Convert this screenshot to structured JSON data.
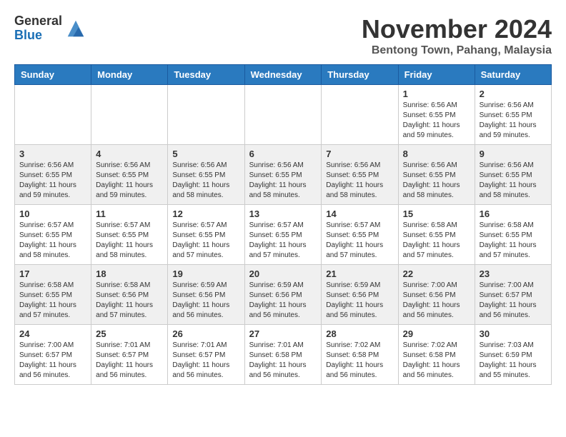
{
  "header": {
    "logo_line1": "General",
    "logo_line2": "Blue",
    "month": "November 2024",
    "location": "Bentong Town, Pahang, Malaysia"
  },
  "weekdays": [
    "Sunday",
    "Monday",
    "Tuesday",
    "Wednesday",
    "Thursday",
    "Friday",
    "Saturday"
  ],
  "weeks": [
    [
      {
        "day": "",
        "info": ""
      },
      {
        "day": "",
        "info": ""
      },
      {
        "day": "",
        "info": ""
      },
      {
        "day": "",
        "info": ""
      },
      {
        "day": "",
        "info": ""
      },
      {
        "day": "1",
        "info": "Sunrise: 6:56 AM\nSunset: 6:55 PM\nDaylight: 11 hours and 59 minutes."
      },
      {
        "day": "2",
        "info": "Sunrise: 6:56 AM\nSunset: 6:55 PM\nDaylight: 11 hours and 59 minutes."
      }
    ],
    [
      {
        "day": "3",
        "info": "Sunrise: 6:56 AM\nSunset: 6:55 PM\nDaylight: 11 hours and 59 minutes."
      },
      {
        "day": "4",
        "info": "Sunrise: 6:56 AM\nSunset: 6:55 PM\nDaylight: 11 hours and 59 minutes."
      },
      {
        "day": "5",
        "info": "Sunrise: 6:56 AM\nSunset: 6:55 PM\nDaylight: 11 hours and 58 minutes."
      },
      {
        "day": "6",
        "info": "Sunrise: 6:56 AM\nSunset: 6:55 PM\nDaylight: 11 hours and 58 minutes."
      },
      {
        "day": "7",
        "info": "Sunrise: 6:56 AM\nSunset: 6:55 PM\nDaylight: 11 hours and 58 minutes."
      },
      {
        "day": "8",
        "info": "Sunrise: 6:56 AM\nSunset: 6:55 PM\nDaylight: 11 hours and 58 minutes."
      },
      {
        "day": "9",
        "info": "Sunrise: 6:56 AM\nSunset: 6:55 PM\nDaylight: 11 hours and 58 minutes."
      }
    ],
    [
      {
        "day": "10",
        "info": "Sunrise: 6:57 AM\nSunset: 6:55 PM\nDaylight: 11 hours and 58 minutes."
      },
      {
        "day": "11",
        "info": "Sunrise: 6:57 AM\nSunset: 6:55 PM\nDaylight: 11 hours and 58 minutes."
      },
      {
        "day": "12",
        "info": "Sunrise: 6:57 AM\nSunset: 6:55 PM\nDaylight: 11 hours and 57 minutes."
      },
      {
        "day": "13",
        "info": "Sunrise: 6:57 AM\nSunset: 6:55 PM\nDaylight: 11 hours and 57 minutes."
      },
      {
        "day": "14",
        "info": "Sunrise: 6:57 AM\nSunset: 6:55 PM\nDaylight: 11 hours and 57 minutes."
      },
      {
        "day": "15",
        "info": "Sunrise: 6:58 AM\nSunset: 6:55 PM\nDaylight: 11 hours and 57 minutes."
      },
      {
        "day": "16",
        "info": "Sunrise: 6:58 AM\nSunset: 6:55 PM\nDaylight: 11 hours and 57 minutes."
      }
    ],
    [
      {
        "day": "17",
        "info": "Sunrise: 6:58 AM\nSunset: 6:55 PM\nDaylight: 11 hours and 57 minutes."
      },
      {
        "day": "18",
        "info": "Sunrise: 6:58 AM\nSunset: 6:56 PM\nDaylight: 11 hours and 57 minutes."
      },
      {
        "day": "19",
        "info": "Sunrise: 6:59 AM\nSunset: 6:56 PM\nDaylight: 11 hours and 56 minutes."
      },
      {
        "day": "20",
        "info": "Sunrise: 6:59 AM\nSunset: 6:56 PM\nDaylight: 11 hours and 56 minutes."
      },
      {
        "day": "21",
        "info": "Sunrise: 6:59 AM\nSunset: 6:56 PM\nDaylight: 11 hours and 56 minutes."
      },
      {
        "day": "22",
        "info": "Sunrise: 7:00 AM\nSunset: 6:56 PM\nDaylight: 11 hours and 56 minutes."
      },
      {
        "day": "23",
        "info": "Sunrise: 7:00 AM\nSunset: 6:57 PM\nDaylight: 11 hours and 56 minutes."
      }
    ],
    [
      {
        "day": "24",
        "info": "Sunrise: 7:00 AM\nSunset: 6:57 PM\nDaylight: 11 hours and 56 minutes."
      },
      {
        "day": "25",
        "info": "Sunrise: 7:01 AM\nSunset: 6:57 PM\nDaylight: 11 hours and 56 minutes."
      },
      {
        "day": "26",
        "info": "Sunrise: 7:01 AM\nSunset: 6:57 PM\nDaylight: 11 hours and 56 minutes."
      },
      {
        "day": "27",
        "info": "Sunrise: 7:01 AM\nSunset: 6:58 PM\nDaylight: 11 hours and 56 minutes."
      },
      {
        "day": "28",
        "info": "Sunrise: 7:02 AM\nSunset: 6:58 PM\nDaylight: 11 hours and 56 minutes."
      },
      {
        "day": "29",
        "info": "Sunrise: 7:02 AM\nSunset: 6:58 PM\nDaylight: 11 hours and 56 minutes."
      },
      {
        "day": "30",
        "info": "Sunrise: 7:03 AM\nSunset: 6:59 PM\nDaylight: 11 hours and 55 minutes."
      }
    ]
  ]
}
